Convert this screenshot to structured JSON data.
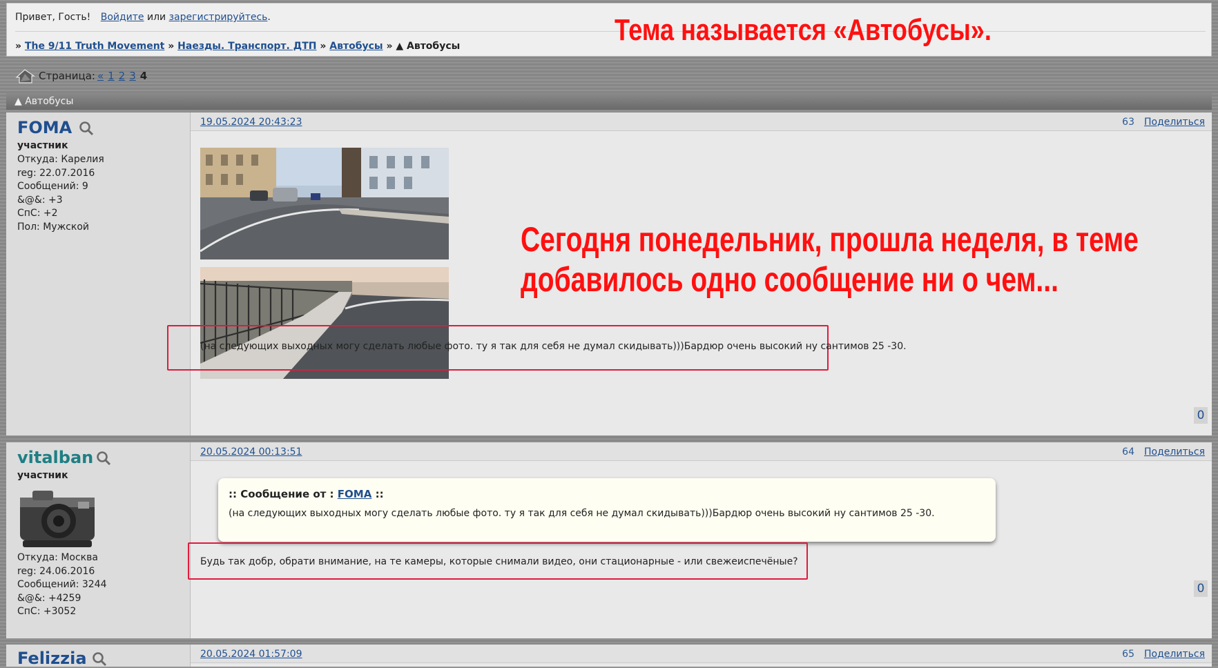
{
  "header": {
    "greeting": "Привет, Гость!",
    "login_link": "Войдите",
    "or_text": "или",
    "register_link": "зарегистрируйтесь",
    "register_tail": ".",
    "breadcrumb_sep": "»",
    "crumbs": [
      "The 9/11 Truth Movement",
      "Наезды. Транспорт. ДТП",
      "Автобусы"
    ],
    "current": "▲ Автобусы"
  },
  "annotations": {
    "top": "Тема называется «Автобусы».",
    "middle_line1": "Сегодня понедельник, прошла неделя, в теме",
    "middle_line2": "добавилось одно сообщение ни о чем..."
  },
  "pager": {
    "label": "Страница:",
    "prev": "«",
    "pages": [
      "1",
      "2",
      "3"
    ],
    "current": "4"
  },
  "topic": {
    "title": "▲ Автобусы"
  },
  "posts": [
    {
      "author": "FOMA",
      "rank": "участник",
      "info": [
        "Откуда: Карелия",
        "reg: 22.07.2016",
        "Сообщений: 9",
        "&@&: +3",
        "СпС: +2",
        "Пол: Мужской"
      ],
      "date": "19.05.2024 20:43:23",
      "number": "63",
      "share": "Поделиться",
      "text": "(на следующих выходных могу сделать любые фото. ту я так для себя не думал скидывать)))Бардюр очень высокий ну сантимов 25 -30.",
      "likes": "0"
    },
    {
      "author": "vitalban",
      "rank": "участник",
      "info": [
        "Откуда: Москва",
        "reg: 24.06.2016",
        "Сообщений: 3244",
        "&@&: +4259",
        "СпС: +3052"
      ],
      "date": "20.05.2024 00:13:51",
      "number": "64",
      "share": "Поделиться",
      "quote_prefix": ":: Сообщение от :",
      "quote_author": "FOMA",
      "quote_suffix": "::",
      "quote_text": "(на следующих выходных могу сделать любые фото. ту я так для себя не думал скидывать)))Бардюр очень высокий ну сантимов 25 -30.",
      "text": "Будь так добр, обрати внимание, на те камеры, которые снимали видео, они стационарные - или свежеиспечёные?",
      "likes": "0"
    },
    {
      "author": "Felizzia",
      "date": "20.05.2024 01:57:09",
      "number": "65",
      "share": "Поделиться"
    }
  ],
  "colors": {
    "annotation": "#ff1010",
    "link": "#1f4f8f",
    "highlight_box": "#e01a3c"
  }
}
